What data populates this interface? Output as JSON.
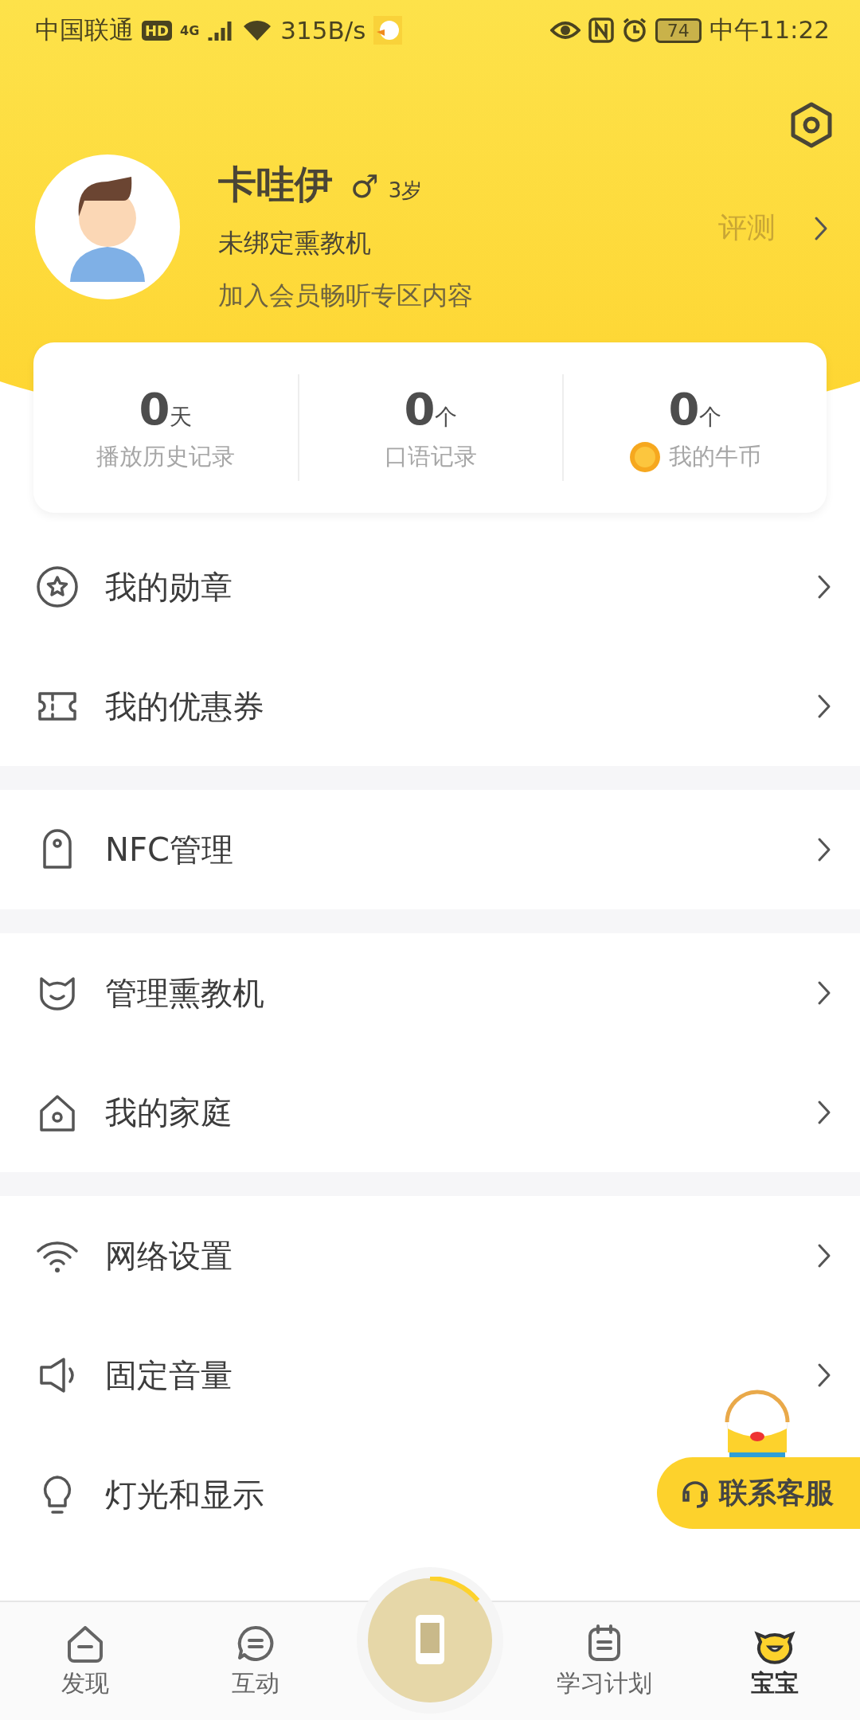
{
  "status_bar": {
    "carrier": "中国联通",
    "hd": "HD",
    "network": "4G",
    "speed": "315B/s",
    "battery": "74",
    "time": "中午11:22"
  },
  "profile": {
    "name": "卡哇伊",
    "gender": "♂",
    "age": "3岁",
    "device_status": "未绑定熏教机",
    "member_hint": "加入会员畅听专区内容",
    "assess": "评测"
  },
  "stats": [
    {
      "value": "0",
      "unit": "天",
      "label": "播放历史记录",
      "coin": false
    },
    {
      "value": "0",
      "unit": "个",
      "label": "口语记录",
      "coin": false
    },
    {
      "value": "0",
      "unit": "个",
      "label": "我的牛币",
      "coin": true
    }
  ],
  "menu_groups": [
    {
      "items": [
        {
          "label": "我的勋章"
        },
        {
          "label": "我的优惠券"
        }
      ]
    },
    {
      "items": [
        {
          "label": "NFC管理"
        }
      ]
    },
    {
      "items": [
        {
          "label": "管理熏教机"
        },
        {
          "label": "我的家庭"
        }
      ]
    },
    {
      "items": [
        {
          "label": "网络设置"
        },
        {
          "label": "固定音量"
        },
        {
          "label": "灯光和显示"
        }
      ]
    }
  ],
  "contact_button": "联系客服",
  "bottom_nav": [
    {
      "label": "发现",
      "selected": false
    },
    {
      "label": "互动",
      "selected": false
    },
    {
      "label": "学习计划",
      "selected": false
    },
    {
      "label": "宝宝",
      "selected": true
    }
  ]
}
